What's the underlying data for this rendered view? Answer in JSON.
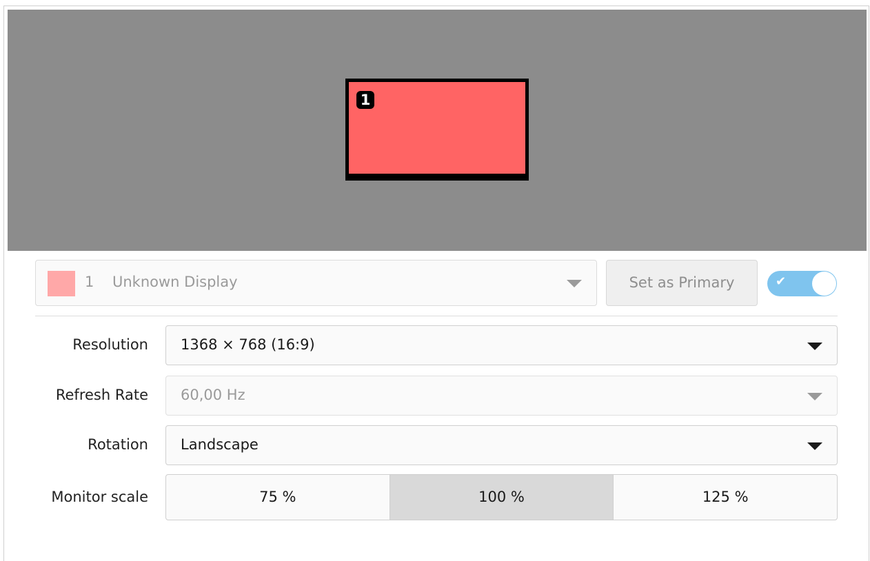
{
  "preview": {
    "monitor_number": "1",
    "monitor_color": "#ff6464",
    "background_color": "#8c8c8c"
  },
  "display": {
    "number": "1",
    "name": "Unknown Display",
    "swatch_color": "#ffa8a8",
    "set_primary_label": "Set as Primary",
    "enabled": true
  },
  "settings": {
    "resolution_label": "Resolution",
    "resolution_value": "1368 × 768 (16:9)",
    "refresh_label": "Refresh Rate",
    "refresh_value": "60,00 Hz",
    "rotation_label": "Rotation",
    "rotation_value": "Landscape",
    "scale_label": "Monitor scale",
    "scale_options": [
      "75 %",
      "100 %",
      "125 %"
    ],
    "scale_selected": "100 %"
  },
  "colors": {
    "accent": "#7fc4ee"
  }
}
